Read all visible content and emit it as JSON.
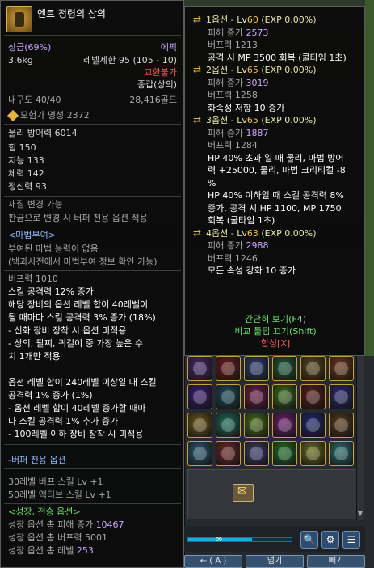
{
  "item": {
    "title": "엔트 정령의 상의",
    "grade": "상급(69%)",
    "rarity": "에픽",
    "weight": "3.6kg",
    "level_req": "레벨제한 95 (105 - 10)",
    "trade": "교환불가",
    "armor_type": "중갑(상의)",
    "durability": "내구도 40/40",
    "price": "28,416골드",
    "adventurer_fame": "모험가 명성 2372"
  },
  "stats": [
    "물리 방어력 6014",
    "힘 150",
    "지능 133",
    "체력 142",
    "정신력 93"
  ],
  "material": {
    "line1": "재질 변경 가능",
    "line2": "판금으로 변경 시 버퍼 전용 옵션 적용"
  },
  "magic_seal": {
    "header": "<마법부여>",
    "line1": "부여된 마법 능력이 없음",
    "line2": "(백과사전에서 마법부여 정보 확인 가능)"
  },
  "buff_power": "버프력 1010",
  "skill_effect": [
    "스킬 공격력 12% 증가",
    "해당 장비의 옵션 레벨 합이 40레벨이",
    "될 때마다 스킬 공격력 3% 증가 (18%)",
    "- 신화 장비 장착 시 옵션 미적용",
    "- 상의, 팔찌, 귀걸이 중 가장 높은 수",
    "치 1개만 적용",
    "",
    "옵션 레벨 합이 240레벨 이상일 때 스킬",
    "공격력 1% 증가 (1%)",
    "- 옵션 레벨 합이 40레벨 증가할 때마",
    "다 스킬 공격력 1% 추가 증가",
    "- 100레벨 이하 장비 장착 시 미적용"
  ],
  "buffer": {
    "header": "-버퍼 전용 옵션",
    "line1": "30레벨 버프 스킬 Lv +1",
    "line2": "50레벨 액티브 스킬 Lv +1"
  },
  "growth": {
    "header": "<성장, 전승 옵션>",
    "dmg_label": "성장 옵션 총 피해 증가 ",
    "dmg_value": "10467",
    "buff_line": "성장 옵션 총 버프력 5001",
    "level_label": "성장 옵션 총 레벨 ",
    "level_value": "253"
  },
  "options": [
    {
      "title": "1옵션 - Lv",
      "level": "60",
      "exp": " (EXP 0.00%)",
      "dmg_label": "피해 증가 ",
      "dmg_value": "2573",
      "buff": "버프력 1213",
      "effect": [
        "공격 시 MP 3500 회복 (쿨타임 1초)"
      ]
    },
    {
      "title": "2옵션 - Lv",
      "level": "65",
      "exp": " (EXP 0.00%)",
      "dmg_label": "피해 증가 ",
      "dmg_value": "3019",
      "buff": "버프력 1258",
      "effect": [
        "화속성 저항 10 증가"
      ]
    },
    {
      "title": "3옵션 - Lv",
      "level": "65",
      "exp": " (EXP 0.00%)",
      "dmg_label": "피해 증가 ",
      "dmg_value": "1887",
      "buff": "버프력 1284",
      "effect": [
        "HP 40% 초과 일 때 물리, 마법 방어",
        "력 +25000, 물리, 마법 크리티컬 -8",
        "%",
        "HP 40% 이하일 때 스킬 공격력 8%",
        "증가, 공격 시 HP 1100, MP 1750",
        "회복 (쿨타임 1초)"
      ]
    },
    {
      "title": "4옵션 - Lv",
      "level": "63",
      "exp": " (EXP 0.00%)",
      "dmg_label": "피해 증가 ",
      "dmg_value": "2988",
      "buff": "버프력 1246",
      "effect": [
        "모든 속성 강화 10 증가"
      ]
    }
  ],
  "footer": {
    "shortcut_f4": "간단히 보기(F4)",
    "shortcut_shift": "비교 툴팁 끄기(Shift)",
    "synth": "합성[X]"
  },
  "inventory": {
    "infinity": "∞",
    "progress": 0.62,
    "buttons": [
      "넘기",
      "빼기"
    ],
    "move_label": "← ( A )"
  },
  "colors": {
    "epic": "#c9a6ff",
    "untradeable": "#ff4c4c",
    "growth": "#6be06b"
  }
}
